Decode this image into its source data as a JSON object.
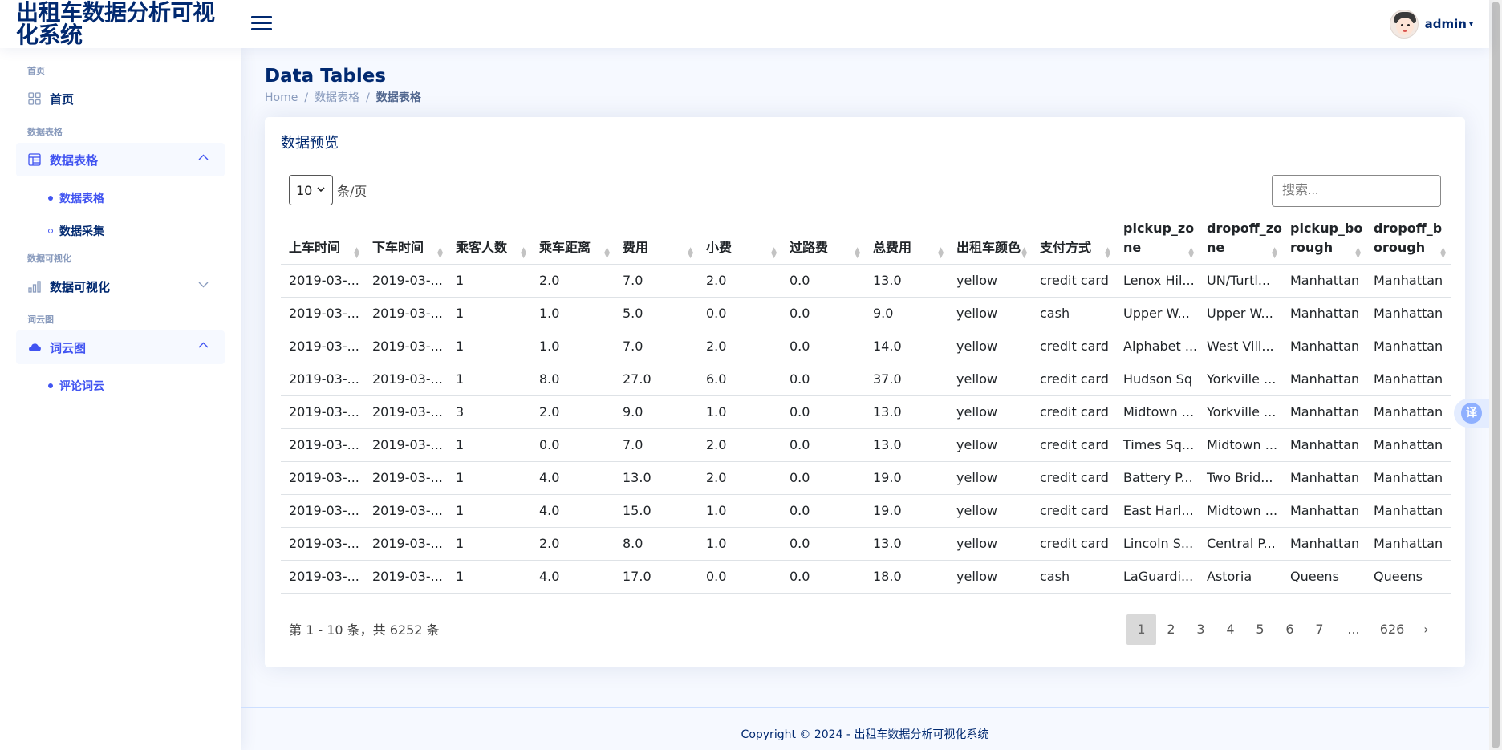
{
  "app": {
    "title": "出租车数据分析可视化系统"
  },
  "header": {
    "user_name": "admin"
  },
  "sidebar": {
    "sections": [
      {
        "heading": "首页",
        "item_label": "首页"
      },
      {
        "heading": "数据表格",
        "item_label": "数据表格",
        "subitems": [
          "数据表格",
          "数据采集"
        ]
      },
      {
        "heading": "数据可视化",
        "item_label": "数据可视化"
      },
      {
        "heading": "词云图",
        "item_label": "词云图",
        "subitems": [
          "评论词云"
        ]
      }
    ]
  },
  "page": {
    "title": "Data Tables",
    "breadcrumb": [
      "Home",
      "数据表格",
      "数据表格"
    ]
  },
  "card": {
    "title": "数据预览",
    "per_page_value": "10",
    "per_page_label": "条/页",
    "search_placeholder": "搜索...",
    "columns": [
      "上车时间",
      "下车时间",
      "乘客人数",
      "乘车距离",
      "费用",
      "小费",
      "过路费",
      "总费用",
      "出租车颜色",
      "支付方式",
      "pickup_zo ne",
      "dropoff_zo ne",
      "pickup_bo rough",
      "dropoff_b orough"
    ],
    "rows": [
      [
        "2019-03-...",
        "2019-03-...",
        "1",
        "2.0",
        "7.0",
        "2.0",
        "0.0",
        "13.0",
        "yellow",
        "credit card",
        "Lenox Hil...",
        "UN/Turtl...",
        "Manhattan",
        "Manhattan"
      ],
      [
        "2019-03-...",
        "2019-03-...",
        "1",
        "1.0",
        "5.0",
        "0.0",
        "0.0",
        "9.0",
        "yellow",
        "cash",
        "Upper W...",
        "Upper W...",
        "Manhattan",
        "Manhattan"
      ],
      [
        "2019-03-...",
        "2019-03-...",
        "1",
        "1.0",
        "7.0",
        "2.0",
        "0.0",
        "14.0",
        "yellow",
        "credit card",
        "Alphabet ...",
        "West Vill...",
        "Manhattan",
        "Manhattan"
      ],
      [
        "2019-03-...",
        "2019-03-...",
        "1",
        "8.0",
        "27.0",
        "6.0",
        "0.0",
        "37.0",
        "yellow",
        "credit card",
        "Hudson Sq",
        "Yorkville ...",
        "Manhattan",
        "Manhattan"
      ],
      [
        "2019-03-...",
        "2019-03-...",
        "3",
        "2.0",
        "9.0",
        "1.0",
        "0.0",
        "13.0",
        "yellow",
        "credit card",
        "Midtown ...",
        "Yorkville ...",
        "Manhattan",
        "Manhattan"
      ],
      [
        "2019-03-...",
        "2019-03-...",
        "1",
        "0.0",
        "7.0",
        "2.0",
        "0.0",
        "13.0",
        "yellow",
        "credit card",
        "Times Sq...",
        "Midtown ...",
        "Manhattan",
        "Manhattan"
      ],
      [
        "2019-03-...",
        "2019-03-...",
        "1",
        "4.0",
        "13.0",
        "2.0",
        "0.0",
        "19.0",
        "yellow",
        "credit card",
        "Battery P...",
        "Two Brid...",
        "Manhattan",
        "Manhattan"
      ],
      [
        "2019-03-...",
        "2019-03-...",
        "1",
        "4.0",
        "15.0",
        "1.0",
        "0.0",
        "19.0",
        "yellow",
        "credit card",
        "East Harl...",
        "Midtown ...",
        "Manhattan",
        "Manhattan"
      ],
      [
        "2019-03-...",
        "2019-03-...",
        "1",
        "2.0",
        "8.0",
        "1.0",
        "0.0",
        "13.0",
        "yellow",
        "credit card",
        "Lincoln S...",
        "Central P...",
        "Manhattan",
        "Manhattan"
      ],
      [
        "2019-03-...",
        "2019-03-...",
        "1",
        "4.0",
        "17.0",
        "0.0",
        "0.0",
        "18.0",
        "yellow",
        "cash",
        "LaGuardi...",
        "Astoria",
        "Queens",
        "Queens"
      ]
    ],
    "info": "第 1 - 10 条，共 6252 条",
    "pages": [
      "1",
      "2",
      "3",
      "4",
      "5",
      "6",
      "7",
      "...",
      "626",
      "›"
    ],
    "current_page": "1"
  },
  "footer": {
    "prefix": "Copyright © 2024 - ",
    "link": "出租车数据分析可视化系统"
  },
  "translate": {
    "label": "译"
  },
  "colors": {
    "brand": "#012970",
    "accent": "#4154f1",
    "muted": "#899bbd"
  }
}
